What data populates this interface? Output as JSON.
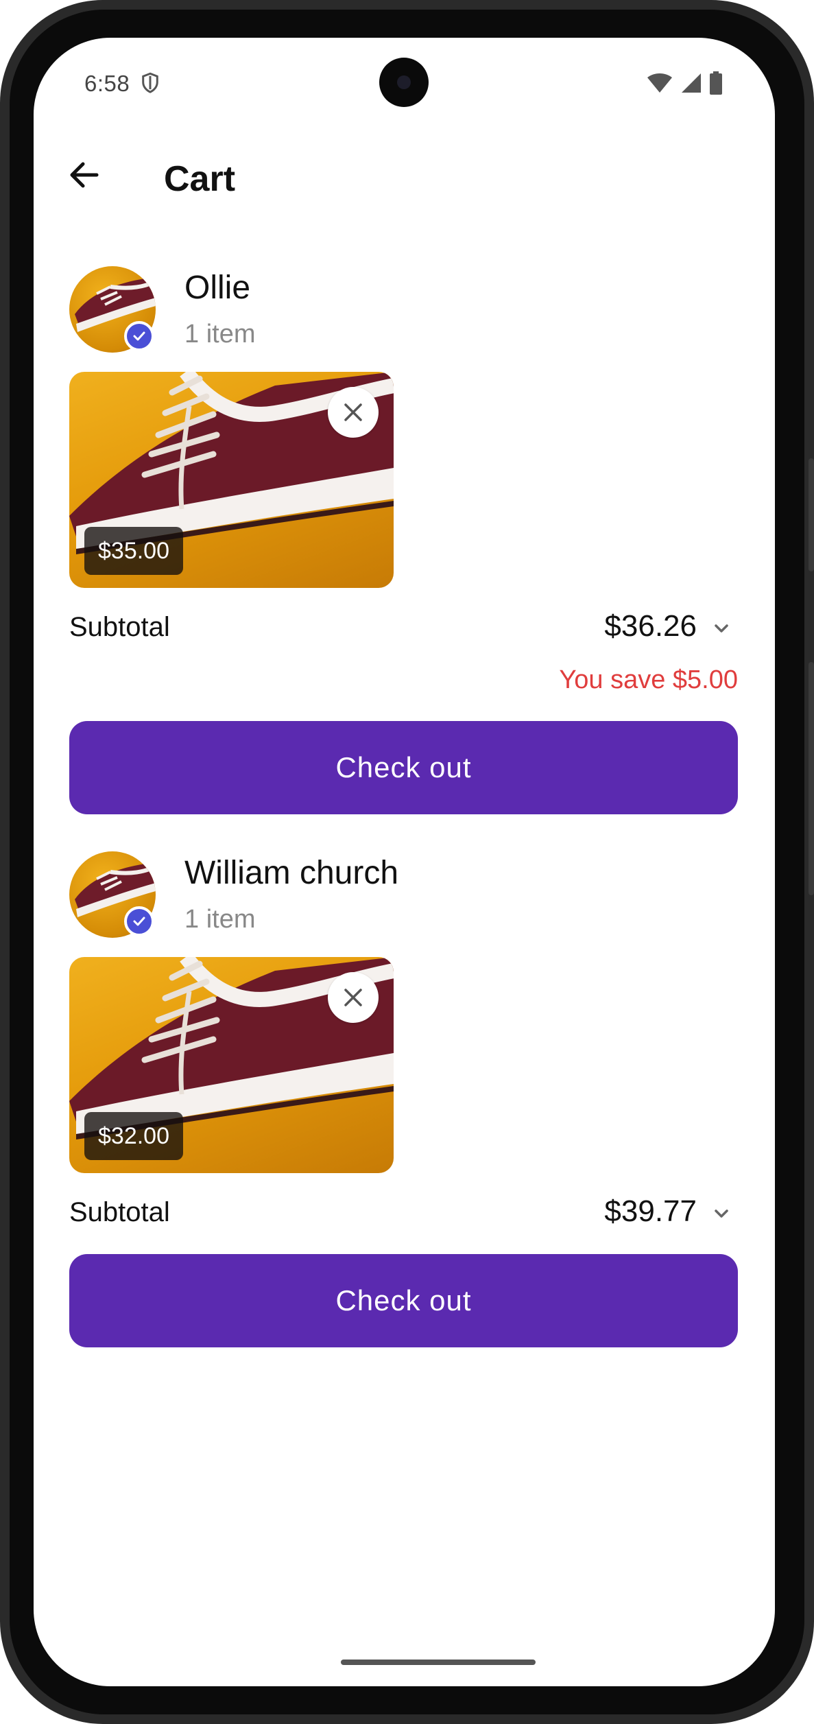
{
  "status_bar": {
    "time": "6:58"
  },
  "header": {
    "title": "Cart"
  },
  "stores": [
    {
      "name": "Ollie",
      "item_count": "1 item",
      "item_price": "$35.00",
      "subtotal_label": "Subtotal",
      "subtotal_value": "$36.26",
      "savings": "You save $5.00",
      "checkout_label": "Check out"
    },
    {
      "name": "William church",
      "item_count": "1 item",
      "item_price": "$32.00",
      "subtotal_label": "Subtotal",
      "subtotal_value": "$39.77",
      "checkout_label": "Check out"
    }
  ],
  "colors": {
    "accent": "#5b2ab0",
    "savings": "#e03d3d",
    "verified_badge": "#4a4fd6"
  },
  "icons": [
    "back-arrow-icon",
    "shield-icon",
    "wifi-icon",
    "signal-icon",
    "battery-icon",
    "verified-icon",
    "close-icon",
    "chevron-down-icon"
  ]
}
